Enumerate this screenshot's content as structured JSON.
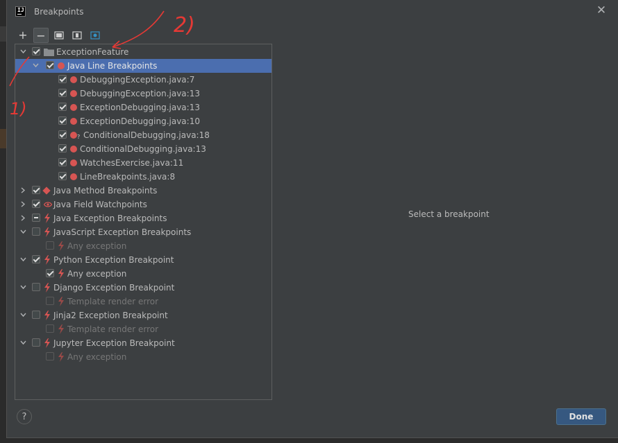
{
  "window": {
    "title": "Breakpoints",
    "app_icon_text": "IJ"
  },
  "toolbar": {
    "add_label": "+",
    "remove_label": "−"
  },
  "tree": {
    "items": [
      {
        "label": "ExceptionFeature",
        "checked": "checked",
        "expander": "open",
        "icon": "folder-icon",
        "level": 0
      },
      {
        "label": "Java Line Breakpoints",
        "checked": "checked",
        "expander": "open",
        "icon": "breakpoint-dot-icon",
        "level": 1,
        "selected": true
      },
      {
        "label": "DebuggingException.java:7",
        "checked": "checked",
        "icon": "breakpoint-dot-icon",
        "level": 2
      },
      {
        "label": "DebuggingException.java:13",
        "checked": "checked",
        "icon": "breakpoint-dot-icon",
        "level": 2
      },
      {
        "label": "ExceptionDebugging.java:13",
        "checked": "checked",
        "icon": "breakpoint-dot-icon",
        "level": 2
      },
      {
        "label": "ExceptionDebugging.java:10",
        "checked": "checked",
        "icon": "breakpoint-dot-icon",
        "level": 2
      },
      {
        "label": "ConditionalDebugging.java:18",
        "checked": "checked",
        "icon": "conditional-breakpoint-icon",
        "level": 2,
        "badge": "?"
      },
      {
        "label": "ConditionalDebugging.java:13",
        "checked": "checked",
        "icon": "breakpoint-dot-icon",
        "level": 2
      },
      {
        "label": "WatchesExercise.java:11",
        "checked": "checked",
        "icon": "breakpoint-dot-icon",
        "level": 2
      },
      {
        "label": "LineBreakpoints.java:8",
        "checked": "checked",
        "icon": "breakpoint-dot-icon",
        "level": 2
      },
      {
        "label": "Java Method Breakpoints",
        "checked": "checked",
        "expander": "closed",
        "icon": "method-breakpoint-icon",
        "level": 0
      },
      {
        "label": "Java Field Watchpoints",
        "checked": "checked",
        "expander": "closed",
        "icon": "field-watchpoint-icon",
        "level": 0
      },
      {
        "label": "Java Exception Breakpoints",
        "checked": "partial",
        "expander": "closed",
        "icon": "exception-bolt-icon",
        "level": 0
      },
      {
        "label": "JavaScript Exception Breakpoints",
        "checked": "unchecked",
        "expander": "open",
        "icon": "exception-bolt-icon",
        "level": 0
      },
      {
        "label": "Any exception",
        "checked": "unchecked",
        "icon": "exception-bolt-icon",
        "level": 1,
        "disabled": true
      },
      {
        "label": "Python Exception Breakpoint",
        "checked": "checked",
        "expander": "open",
        "icon": "exception-bolt-icon",
        "level": 0
      },
      {
        "label": "Any exception",
        "checked": "checked",
        "icon": "exception-bolt-icon",
        "level": 1
      },
      {
        "label": "Django Exception Breakpoint",
        "checked": "unchecked",
        "expander": "open",
        "icon": "exception-bolt-icon",
        "level": 0
      },
      {
        "label": "Template render error",
        "checked": "unchecked",
        "icon": "exception-bolt-icon",
        "level": 1,
        "disabled": true
      },
      {
        "label": "Jinja2 Exception Breakpoint",
        "checked": "unchecked",
        "expander": "open",
        "icon": "exception-bolt-icon",
        "level": 0
      },
      {
        "label": "Template render error",
        "checked": "unchecked",
        "icon": "exception-bolt-icon",
        "level": 1,
        "disabled": true
      },
      {
        "label": "Jupyter Exception Breakpoint",
        "checked": "unchecked",
        "expander": "open",
        "icon": "exception-bolt-icon",
        "level": 0
      },
      {
        "label": "Any exception",
        "checked": "unchecked",
        "icon": "exception-bolt-icon",
        "level": 1,
        "disabled": true
      }
    ]
  },
  "details": {
    "empty_text": "Select a breakpoint"
  },
  "footer": {
    "help_label": "?",
    "done_label": "Done"
  },
  "annotations": {
    "mark_1": "1)",
    "mark_2": "2)"
  },
  "colors": {
    "accent": "#4b6eaf",
    "breakpoint_red": "#d75553",
    "done_button": "#365880",
    "annotation_red": "#e53935"
  }
}
